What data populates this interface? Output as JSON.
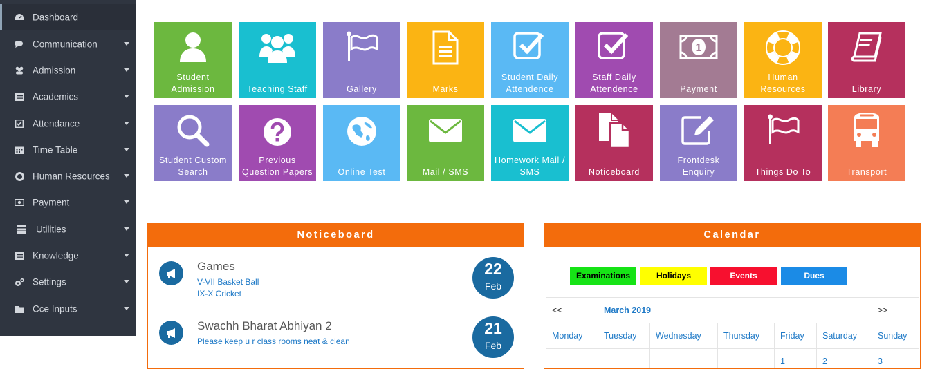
{
  "sidebar": {
    "items": [
      {
        "label": "Dashboard",
        "icon": "dashboard-icon"
      },
      {
        "label": "Communication",
        "icon": "comments-icon"
      },
      {
        "label": "Admission",
        "icon": "users-icon"
      },
      {
        "label": "Academics",
        "icon": "list-icon"
      },
      {
        "label": "Attendance",
        "icon": "check-square-icon"
      },
      {
        "label": "Time Table",
        "icon": "calendar-icon"
      },
      {
        "label": "Human Resources",
        "icon": "life-ring-icon"
      },
      {
        "label": "Payment",
        "icon": "money-icon"
      },
      {
        "label": "Utilities",
        "icon": "server-icon"
      },
      {
        "label": "Knowledge",
        "icon": "book-icon"
      },
      {
        "label": "Settings",
        "icon": "cogs-icon"
      },
      {
        "label": "Cce Inputs",
        "icon": "folder-icon"
      }
    ]
  },
  "tiles": [
    {
      "label": "Student Admission",
      "icon": "user-icon",
      "color": "#6cb83f"
    },
    {
      "label": "Teaching Staff",
      "icon": "group-icon",
      "color": "#19bfd0"
    },
    {
      "label": "Gallery",
      "icon": "flag-icon",
      "color": "#8a7cc9"
    },
    {
      "label": "Marks",
      "icon": "document-icon",
      "color": "#fbb413"
    },
    {
      "label": "Student Daily Attendence",
      "icon": "check-square-icon",
      "color": "#5ab9f4"
    },
    {
      "label": "Staff Daily Attendence",
      "icon": "check-square-icon",
      "color": "#a04bb0"
    },
    {
      "label": "Payment",
      "icon": "money-icon",
      "color": "#a37b93"
    },
    {
      "label": "Human Resources",
      "icon": "life-ring-icon",
      "color": "#fbb413"
    },
    {
      "label": "Library",
      "icon": "book-icon",
      "color": "#b5305d"
    },
    {
      "label": "Student Custom Search",
      "icon": "search-icon",
      "color": "#8a7cc9"
    },
    {
      "label": "Previous Question Papers",
      "icon": "question-icon",
      "color": "#a04bb0"
    },
    {
      "label": "Online Test",
      "icon": "globe-icon",
      "color": "#5ab9f4"
    },
    {
      "label": "Mail / SMS",
      "icon": "envelope-icon",
      "color": "#6cb83f"
    },
    {
      "label": "Homework Mail / SMS",
      "icon": "envelope-icon",
      "color": "#19bfd0"
    },
    {
      "label": "Noticeboard",
      "icon": "files-icon",
      "color": "#b5305d"
    },
    {
      "label": "Frontdesk Enquiry",
      "icon": "edit-icon",
      "color": "#8a7cc9"
    },
    {
      "label": "Things Do To",
      "icon": "flag-icon",
      "color": "#b5305d"
    },
    {
      "label": "Transport",
      "icon": "bus-icon",
      "color": "#f47d55"
    }
  ],
  "noticeboard": {
    "title": "Noticeboard",
    "items": [
      {
        "title": "Games",
        "lines": [
          "V-VII Basket Ball",
          "IX-X Cricket"
        ],
        "day": "22",
        "month": "Feb"
      },
      {
        "title": "Swachh Bharat Abhiyan 2",
        "lines": [
          "Please keep u r class rooms neat & clean"
        ],
        "day": "21",
        "month": "Feb"
      }
    ]
  },
  "calendar": {
    "title": "Calendar",
    "legend": [
      {
        "label": "Examinations",
        "bg": "#16e316",
        "fg": "#000000"
      },
      {
        "label": "Holidays",
        "bg": "#ffff00",
        "fg": "#000000"
      },
      {
        "label": "Events",
        "bg": "#f7102f",
        "fg": "#ffffff"
      },
      {
        "label": "Dues",
        "bg": "#1b8be6",
        "fg": "#ffffff"
      }
    ],
    "prev": "<<",
    "next": ">>",
    "month": "March 2019",
    "weekdays": [
      "Monday",
      "Tuesday",
      "Wednesday",
      "Thursday",
      "Friday",
      "Saturday",
      "Sunday"
    ],
    "first_row": [
      "",
      "",
      "",
      "",
      "1",
      "2",
      "3"
    ]
  }
}
